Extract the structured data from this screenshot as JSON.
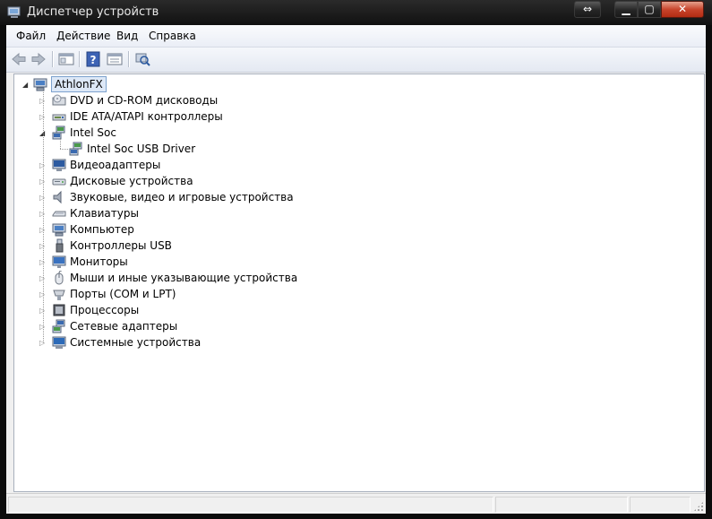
{
  "window": {
    "title": "Диспетчер устройств",
    "close_glyph": "✕",
    "min_glyph": "▁",
    "max_glyph": "▢",
    "swap_glyph": "⇔"
  },
  "menu": {
    "items": [
      "Файл",
      "Действие",
      "Вид",
      "Справка"
    ]
  },
  "toolbar": {
    "buttons": [
      "back-icon",
      "forward-icon",
      "show-hide-console-tree-icon",
      "help-icon",
      "properties-icon",
      "scan-hardware-icon"
    ]
  },
  "tree": {
    "root": {
      "label": "AthlonFX",
      "icon": "computer-icon"
    },
    "categories": [
      {
        "label": "DVD и CD-ROM дисководы",
        "icon": "dvd-drive-icon",
        "expanded": false
      },
      {
        "label": "IDE ATA/ATAPI контроллеры",
        "icon": "ide-controller-icon",
        "expanded": false
      },
      {
        "label": "Intel Soc",
        "icon": "network-device-icon",
        "expanded": true,
        "children": [
          {
            "label": "Intel Soc USB Driver",
            "icon": "network-device-icon"
          }
        ]
      },
      {
        "label": "Видеоадаптеры",
        "icon": "display-adapter-icon",
        "expanded": false
      },
      {
        "label": "Дисковые устройства",
        "icon": "disk-drive-icon",
        "expanded": false
      },
      {
        "label": "Звуковые, видео и игровые устройства",
        "icon": "speaker-icon",
        "expanded": false
      },
      {
        "label": "Клавиатуры",
        "icon": "keyboard-icon",
        "expanded": false
      },
      {
        "label": "Компьютер",
        "icon": "computer-icon",
        "expanded": false
      },
      {
        "label": "Контроллеры USB",
        "icon": "usb-icon",
        "expanded": false
      },
      {
        "label": "Мониторы",
        "icon": "monitor-icon",
        "expanded": false
      },
      {
        "label": "Мыши и иные указывающие устройства",
        "icon": "mouse-icon",
        "expanded": false
      },
      {
        "label": "Порты (COM и LPT)",
        "icon": "port-icon",
        "expanded": false
      },
      {
        "label": "Процессоры",
        "icon": "processor-icon",
        "expanded": false
      },
      {
        "label": "Сетевые адаптеры",
        "icon": "network-adapter-icon",
        "expanded": false
      },
      {
        "label": "Системные устройства",
        "icon": "system-device-icon",
        "expanded": false
      }
    ]
  },
  "glyphs": {
    "collapsed": "▷",
    "expanded": "◢"
  }
}
